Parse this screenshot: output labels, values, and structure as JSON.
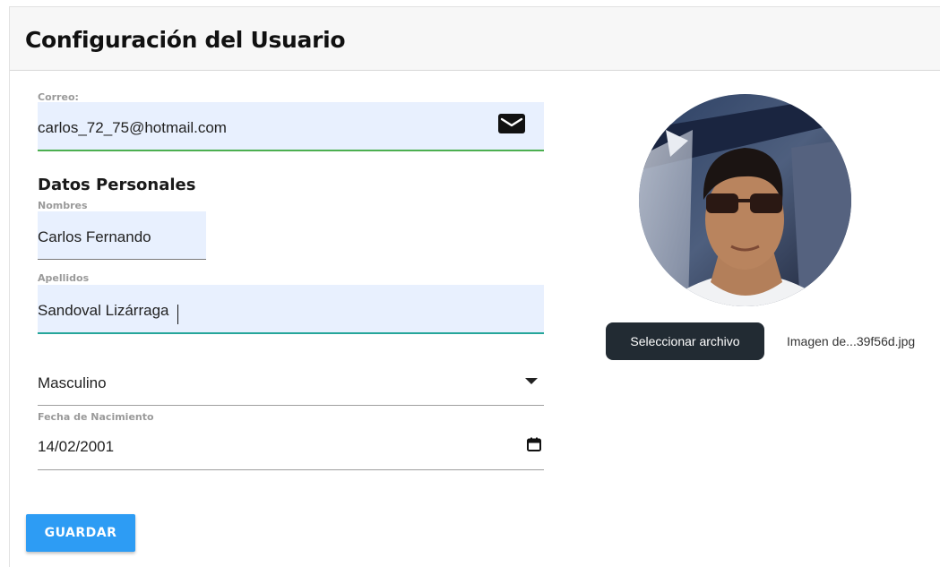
{
  "header": {
    "title": "Configuración del Usuario"
  },
  "email": {
    "label": "Correo:",
    "value": "carlos_72_75@hotmail.com",
    "icon": "envelope-icon"
  },
  "personal": {
    "section_title": "Datos Personales",
    "first_names": {
      "label": "Nombres",
      "value": "Carlos Fernando"
    },
    "last_names": {
      "label": "Apellidos",
      "value": "Sandoval Lizárraga"
    },
    "gender": {
      "value": "Masculino",
      "icon": "dropdown-arrow-icon"
    },
    "birth_date": {
      "label": "Fecha de Nacimiento",
      "value": "14/02/2001",
      "icon": "calendar-icon"
    }
  },
  "actions": {
    "save_label": "GUARDAR"
  },
  "profile_image": {
    "choose_file_label": "Seleccionar archivo",
    "file_name": "Imagen de...39f56d.jpg"
  },
  "colors": {
    "autofill_background": "#e8f0fe",
    "email_underline": "#4caf50",
    "last_name_underline": "#26a69a",
    "save_button": "#2d9cf4",
    "file_button": "#222b33"
  }
}
